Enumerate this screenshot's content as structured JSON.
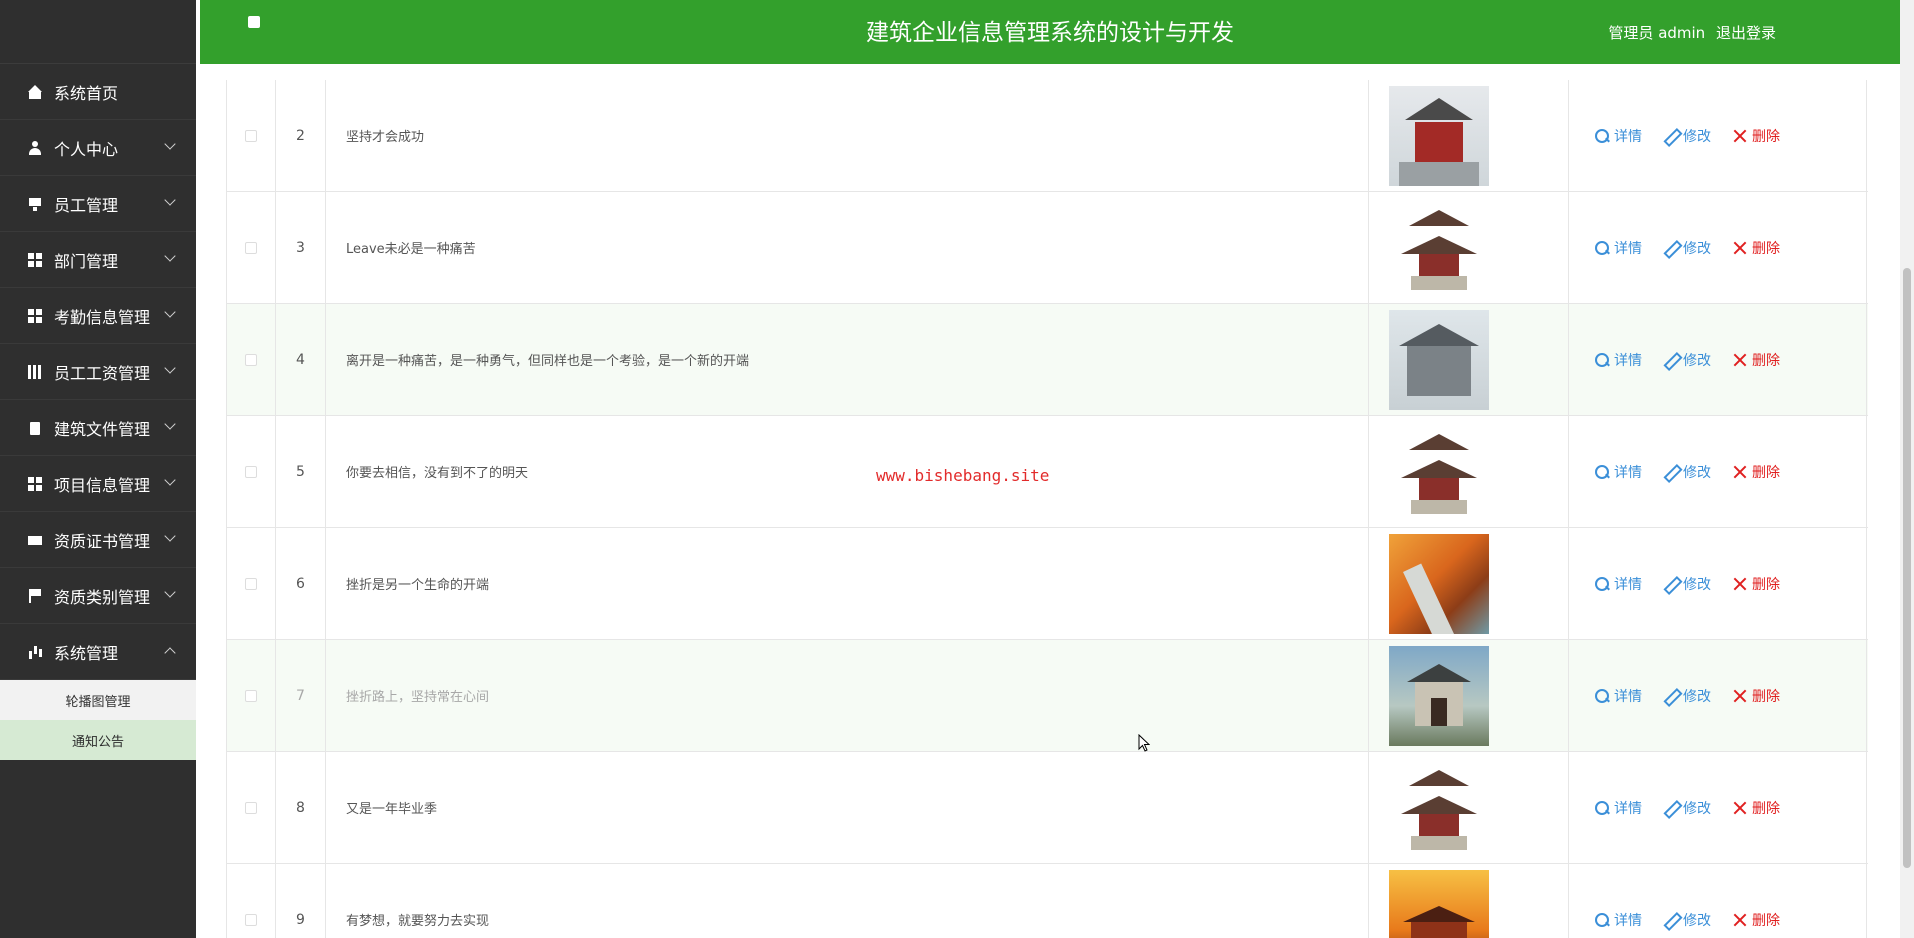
{
  "header": {
    "title": "建筑企业信息管理系统的设计与开发",
    "user_label": "管理员 admin",
    "logout_label": "退出登录"
  },
  "sidebar": {
    "items": [
      {
        "label": "系统首页",
        "icon": "home-icon"
      },
      {
        "label": "个人中心",
        "icon": "user-icon"
      },
      {
        "label": "员工管理",
        "icon": "desktop-icon"
      },
      {
        "label": "部门管理",
        "icon": "grid-icon"
      },
      {
        "label": "考勤信息管理",
        "icon": "grid-icon"
      },
      {
        "label": "员工工资管理",
        "icon": "table-icon"
      },
      {
        "label": "建筑文件管理",
        "icon": "clipboard-icon"
      },
      {
        "label": "项目信息管理",
        "icon": "grid-icon"
      },
      {
        "label": "资质证书管理",
        "icon": "ticket-icon"
      },
      {
        "label": "资质类别管理",
        "icon": "flag-icon"
      },
      {
        "label": "系统管理",
        "icon": "bar-chart-icon"
      }
    ],
    "subitems": [
      {
        "label": "轮播图管理"
      },
      {
        "label": "通知公告"
      }
    ]
  },
  "actions": {
    "detail": "详情",
    "edit": "修改",
    "delete": "删除"
  },
  "rows": [
    {
      "num": "2",
      "title": "坚持才会成功",
      "image": "red-pavilion"
    },
    {
      "num": "3",
      "title": "Leave未必是一种痛苦",
      "image": "pagoda-pavilion"
    },
    {
      "num": "4",
      "title": "离开是一种痛苦，是一种勇气，但同样也是一个考验，是一个新的开端",
      "image": "gray-house"
    },
    {
      "num": "5",
      "title": "你要去相信，没有到不了的明天",
      "image": "pagoda-pavilion"
    },
    {
      "num": "6",
      "title": "挫折是另一个生命的开端",
      "image": "great-wall-autumn"
    },
    {
      "num": "7",
      "title": "挫折路上，坚持常在心间",
      "image": "temple-gate"
    },
    {
      "num": "8",
      "title": "又是一年毕业季",
      "image": "pagoda-pavilion"
    },
    {
      "num": "9",
      "title": "有梦想，就要努力去实现",
      "image": "sunset-palace"
    }
  ],
  "watermark": "www.bishebang.site"
}
